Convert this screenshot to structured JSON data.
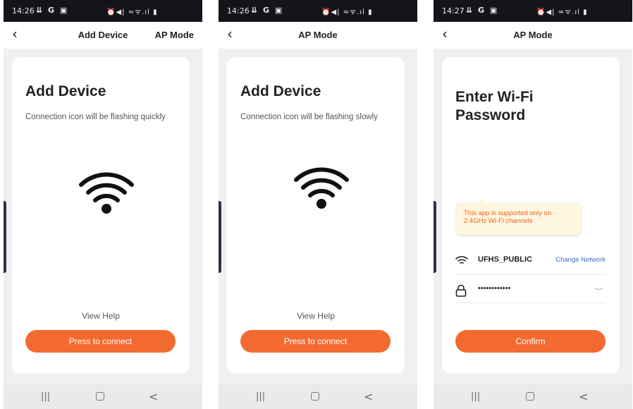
{
  "colors": {
    "accent": "#f26a30",
    "link": "#3c6fc8",
    "tooltip_text": "#f06020",
    "status_bar": "#14151a"
  },
  "screens": [
    {
      "status": {
        "time": "14:26",
        "left_icons": "⇊ G ▣",
        "right_icons": "⏰◀| ≈ᯤ.ıl ▮"
      },
      "nav": {
        "back_icon": "chevron-left-icon",
        "title": "Add Device",
        "action": "AP Mode"
      },
      "card": {
        "title": "Add Device",
        "subtitle": "Connection icon will be flashing quickly",
        "illustration_icon": "wifi-icon",
        "help": "View Help",
        "button": "Press to connect"
      },
      "sysnav": {
        "recent": "|||",
        "home_icon": "home-square-icon",
        "back": "<"
      }
    },
    {
      "status": {
        "time": "14:26",
        "left_icons": "⇊ G ▣",
        "right_icons": "⏰◀| ≈ᯤ.ıl ▮"
      },
      "nav": {
        "back_icon": "chevron-left-icon",
        "title": "AP Mode",
        "action": ""
      },
      "card": {
        "title": "Add Device",
        "subtitle": "Connection icon will be flashing slowly",
        "illustration_icon": "wifi-icon",
        "help": "View Help",
        "button": "Press to connect"
      },
      "sysnav": {
        "recent": "|||",
        "home_icon": "home-square-icon",
        "back": "<"
      }
    },
    {
      "status": {
        "time": "14:27",
        "left_icons": "⇊ G ▣",
        "right_icons": "⏰◀| ≈ᯤ.ıl ▮"
      },
      "nav": {
        "back_icon": "chevron-left-icon",
        "title": "AP Mode",
        "action": ""
      },
      "card": {
        "title": "Enter Wi-Fi Password",
        "tooltip": "This app is supported only on 2.4GHz Wi-Fi channels",
        "ssid": "UFHS_PUBLIC",
        "change_network": "Change Network",
        "password_mask": "••••••••••••",
        "button": "Confirm"
      },
      "sysnav": {
        "recent": "|||",
        "home_icon": "home-square-icon",
        "back": "<"
      }
    }
  ]
}
